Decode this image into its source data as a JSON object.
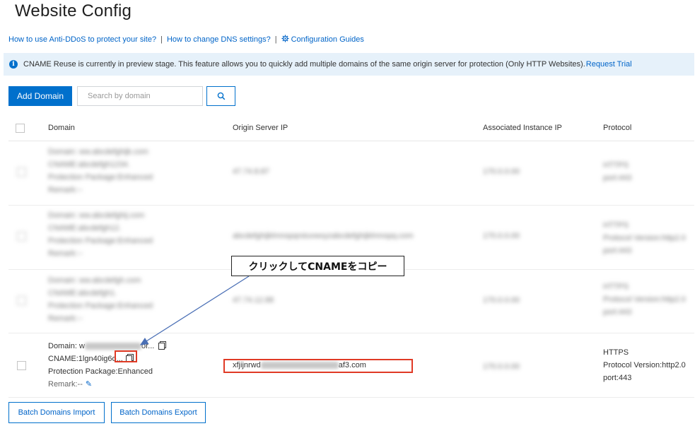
{
  "page": {
    "title": "Website Config"
  },
  "links": {
    "anti_ddos": "How to use Anti-DDoS to protect your site?",
    "separator": "|",
    "dns": "How to change DNS settings?",
    "guides": "Configuration Guides"
  },
  "notice": {
    "text": "CNAME Reuse is currently in preview stage. This feature allows you to quickly add multiple domains of the same origin server for protection (Only HTTP Websites).",
    "link": "Request Trial"
  },
  "toolbar": {
    "add_domain": "Add Domain",
    "search_placeholder": "Search by domain"
  },
  "table": {
    "headers": {
      "domain": "Domain",
      "origin_ip": "Origin Server IP",
      "instance_ip": "Associated Instance IP",
      "protocol": "Protocol"
    },
    "blurred_rows": [
      {
        "domain_lines": [
          "Domain: ww.abcdefghijk.com",
          "CNAME:abcdefgh1234.",
          "Protection Package:Enhanced",
          "Remark:--"
        ],
        "origin_ip": "47.74.8.87",
        "instance_ip": "170.0.0.00",
        "protocol_lines": [
          "HTTPS",
          "port:443"
        ]
      },
      {
        "domain_lines": [
          "Domain: ww.abcdefghij.com",
          "CNAME:abcdefgh12.",
          "Protection Package:Enhanced",
          "Remark:--"
        ],
        "origin_ip": "abcdefghijklmnopqrstuvwxyzabcdefghijklmnopq.com",
        "instance_ip": "170.0.0.00",
        "protocol_lines": [
          "HTTPS",
          "Protocol Version:http2.0",
          "port:443"
        ]
      },
      {
        "domain_lines": [
          "Domain: ww.abcdefgh.com",
          "CNAME:abcdefgh1.",
          "Protection Package:Enhanced",
          "Remark:--"
        ],
        "origin_ip": "47.74.12.88",
        "instance_ip": "170.0.0.00",
        "protocol_lines": [
          "HTTPS",
          "Protocol Version:http2.0",
          "port:443"
        ]
      }
    ],
    "active_row": {
      "domain_prefix": "Domain: w",
      "domain_suffix": "or...",
      "cname": "CNAME:1lgn40ig6o...",
      "package": "Protection Package:Enhanced",
      "remark": "Remark:--",
      "origin_prefix": "xfjijnrwd",
      "origin_suffix": "af3.com",
      "instance_ip": "170.0.0.00",
      "protocol": "HTTPS",
      "protocol_version": "Protocol Version:http2.0",
      "port": "port:443"
    }
  },
  "callout": {
    "text": "クリックしてCNAMEをコピー"
  },
  "footer": {
    "batch_import": "Batch Domains Import",
    "batch_export": "Batch Domains Export"
  },
  "colors": {
    "primary": "#0070cc",
    "highlight": "#e03a25",
    "notice_bg": "#e6f1fa"
  },
  "icons": [
    "info-icon",
    "gear-icon",
    "search-icon",
    "copy-icon",
    "edit-icon"
  ]
}
